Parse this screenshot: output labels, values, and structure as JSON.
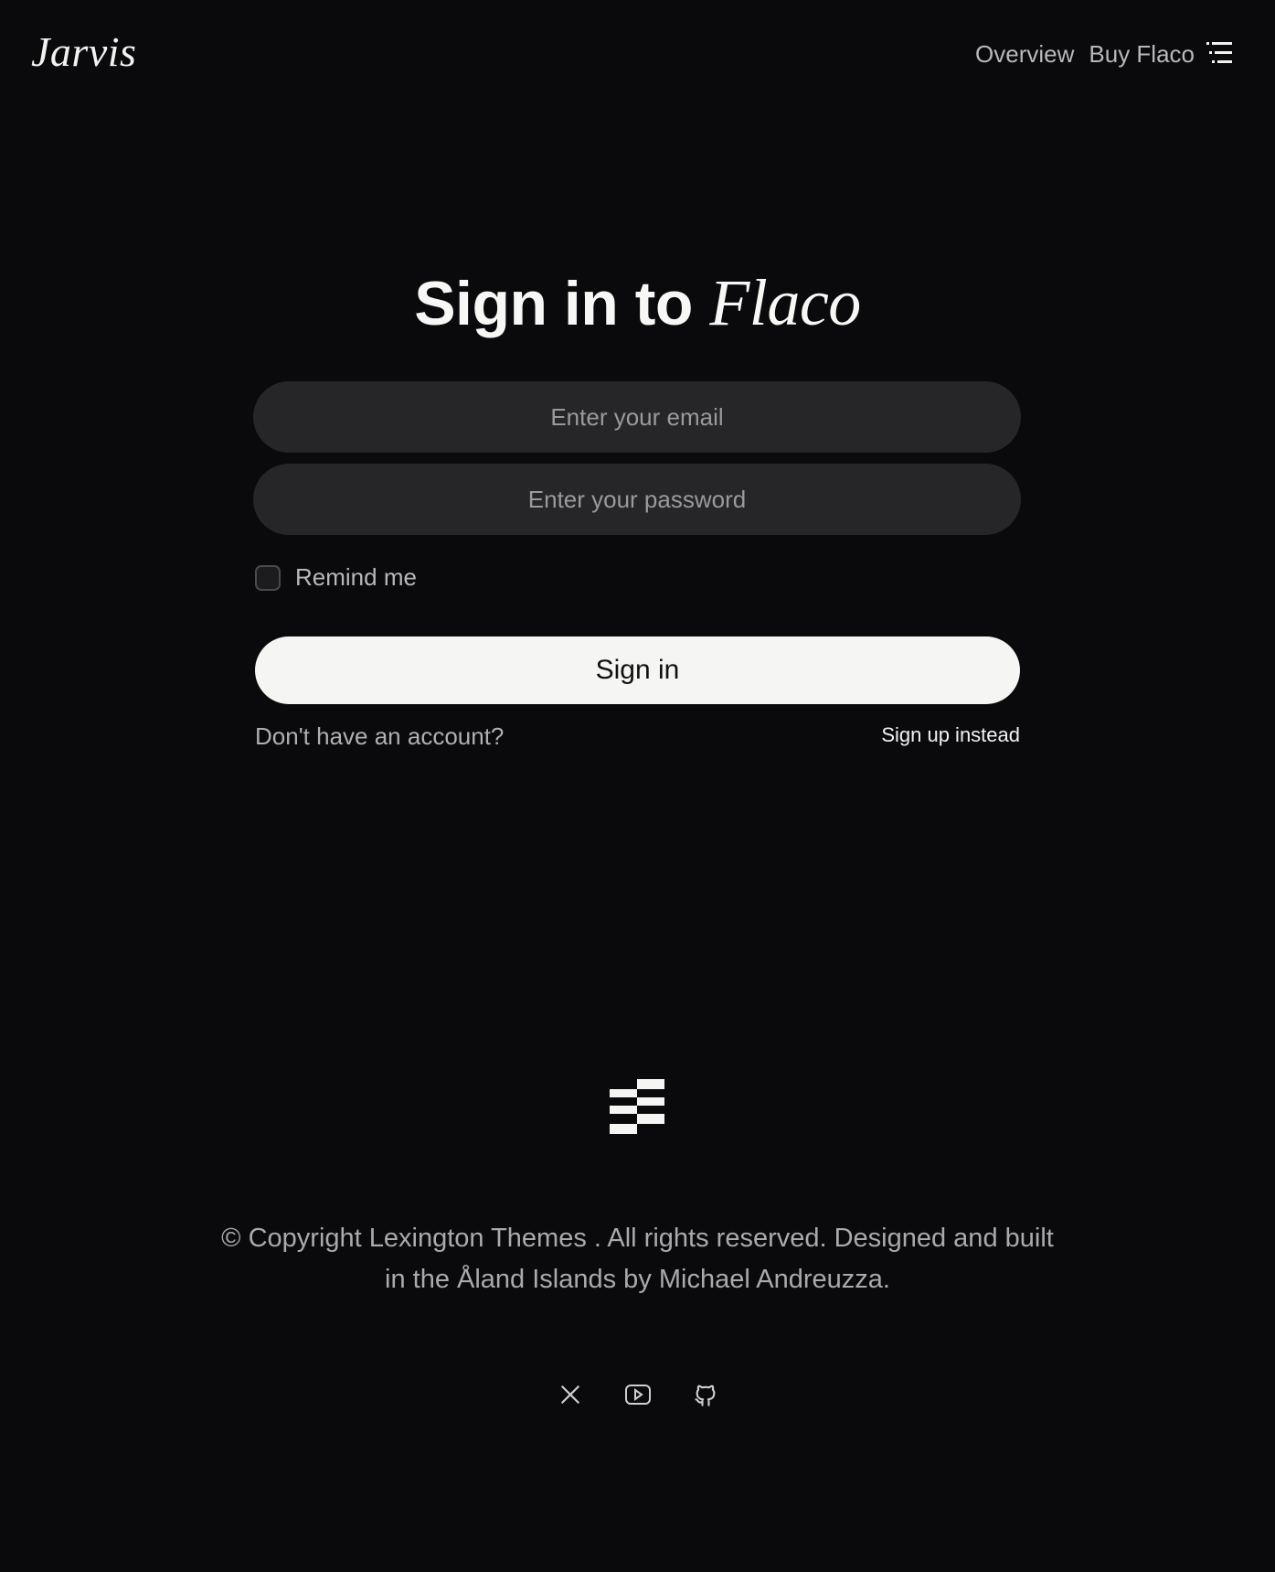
{
  "header": {
    "logo": "Jarvis",
    "nav": [
      "Overview",
      "Buy Flaco"
    ],
    "menu_icon": "menu-lines-icon"
  },
  "form": {
    "title_prefix": "Sign in to",
    "title_brand": "Flaco",
    "email_placeholder": "Enter your email",
    "password_placeholder": "Enter your password",
    "remember_label": "Remind me",
    "submit_label": "Sign in",
    "no_account_text": "Don't have an account?",
    "signup_link": "Sign up instead"
  },
  "footer": {
    "logo_icon": "stacked-bars-logo-icon",
    "copyright": "© Copyright Lexington Themes . All rights reserved. Designed and built in the Åland Islands by Michael Andreuzza.",
    "socials": [
      "x-icon",
      "youtube-icon",
      "github-icon"
    ]
  },
  "colors": {
    "background": "#0a0a0c",
    "input_bg": "#262628",
    "button_bg": "#f5f5f3",
    "text_primary": "#f2f2f0",
    "text_muted": "#aaaaaa"
  }
}
